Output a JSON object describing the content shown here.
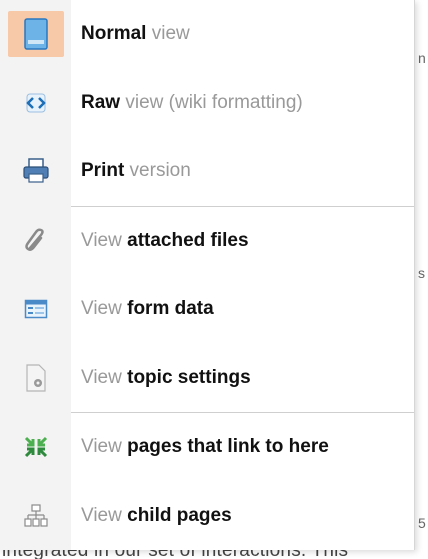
{
  "background": {
    "bottom_text": "integrated in our set of interactions. This",
    "right_fragments": [
      "n",
      "s",
      "5"
    ]
  },
  "menu": {
    "sections": [
      [
        {
          "id": "normal",
          "prefix": "",
          "bold": "Normal",
          "suffix": " view",
          "icon": "page-icon",
          "active": true
        },
        {
          "id": "raw",
          "prefix": "",
          "bold": "Raw",
          "suffix": " view (wiki formatting)",
          "icon": "code-icon",
          "active": false
        },
        {
          "id": "print",
          "prefix": "",
          "bold": "Print",
          "suffix": " version",
          "icon": "printer-icon",
          "active": false
        }
      ],
      [
        {
          "id": "attachments",
          "prefix": "View ",
          "bold": "attached files",
          "suffix": "",
          "icon": "paperclip-icon",
          "active": false
        },
        {
          "id": "form",
          "prefix": "View ",
          "bold": "form data",
          "suffix": "",
          "icon": "form-icon",
          "active": false
        },
        {
          "id": "settings",
          "prefix": "View ",
          "bold": "topic settings",
          "suffix": "",
          "icon": "settings-page-icon",
          "active": false
        }
      ],
      [
        {
          "id": "backlinks",
          "prefix": "View ",
          "bold": "pages that link to here",
          "suffix": "",
          "icon": "backlinks-icon",
          "active": false
        },
        {
          "id": "children",
          "prefix": "View ",
          "bold": "child pages",
          "suffix": "",
          "icon": "hierarchy-icon",
          "active": false
        }
      ]
    ]
  },
  "colors": {
    "active_bg": "#f7c9a9",
    "gutter_bg": "#f3f3f3",
    "label_gray": "#999999",
    "label_bold": "#111111"
  }
}
